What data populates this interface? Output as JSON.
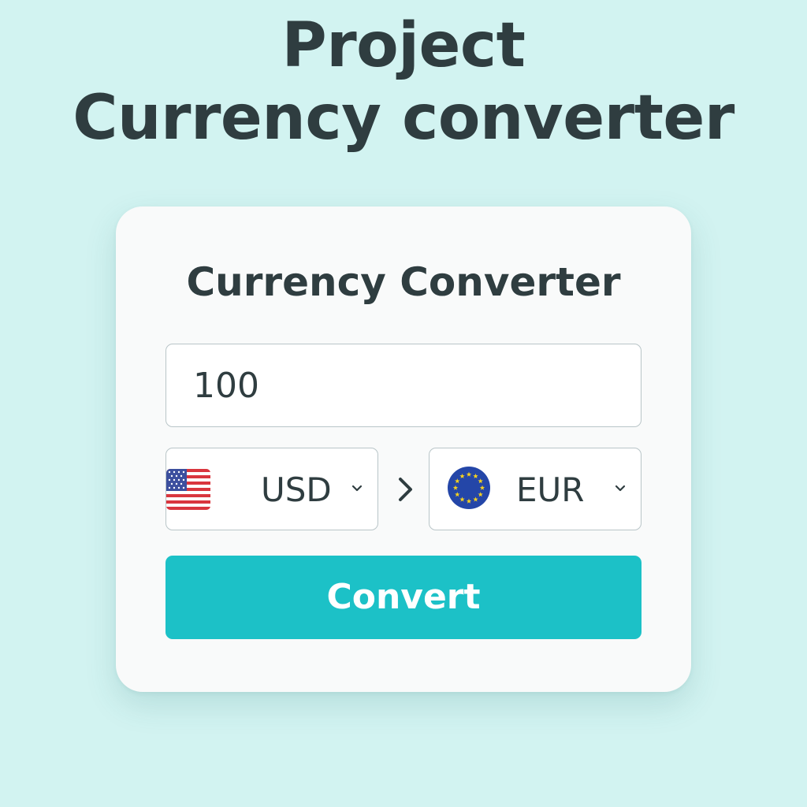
{
  "page": {
    "title_line1": "Project",
    "title_line2": "Currency converter",
    "background_color": "#d2f3f1"
  },
  "converter": {
    "title": "Currency Converter",
    "amount": {
      "value": "100",
      "placeholder": ""
    },
    "from": {
      "code": "USD",
      "flag_icon": "us-flag-icon",
      "dropdown_icon": "chevron-down-icon"
    },
    "swap_icon": "chevron-right-icon",
    "to": {
      "code": "EUR",
      "flag_icon": "eu-flag-icon",
      "dropdown_icon": "chevron-down-icon"
    },
    "convert_label": "Convert",
    "accent_color": "#1cc1c7"
  }
}
